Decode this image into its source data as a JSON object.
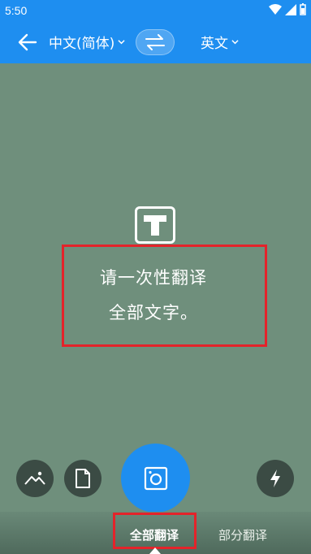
{
  "status_bar": {
    "time": "5:50"
  },
  "app_bar": {
    "source_language": "中文(简体)",
    "target_language": "英文",
    "back_icon": "arrow-left-icon",
    "swap_icon": "swap-arrows-icon"
  },
  "camera": {
    "hint_line_1": "请一次性翻译",
    "hint_line_2": "全部文字。",
    "text_icon": "text-t-icon"
  },
  "controls": {
    "gallery_icon": "image-icon",
    "file_icon": "document-icon",
    "shutter_icon": "camera-icon",
    "flash_icon": "flash-icon"
  },
  "modes": {
    "active": "全部翻译",
    "inactive": "部分翻译"
  },
  "colors": {
    "accent": "#1e8ef0",
    "highlight_border": "#e4232a",
    "camera_bg": "#6f8f7c"
  }
}
